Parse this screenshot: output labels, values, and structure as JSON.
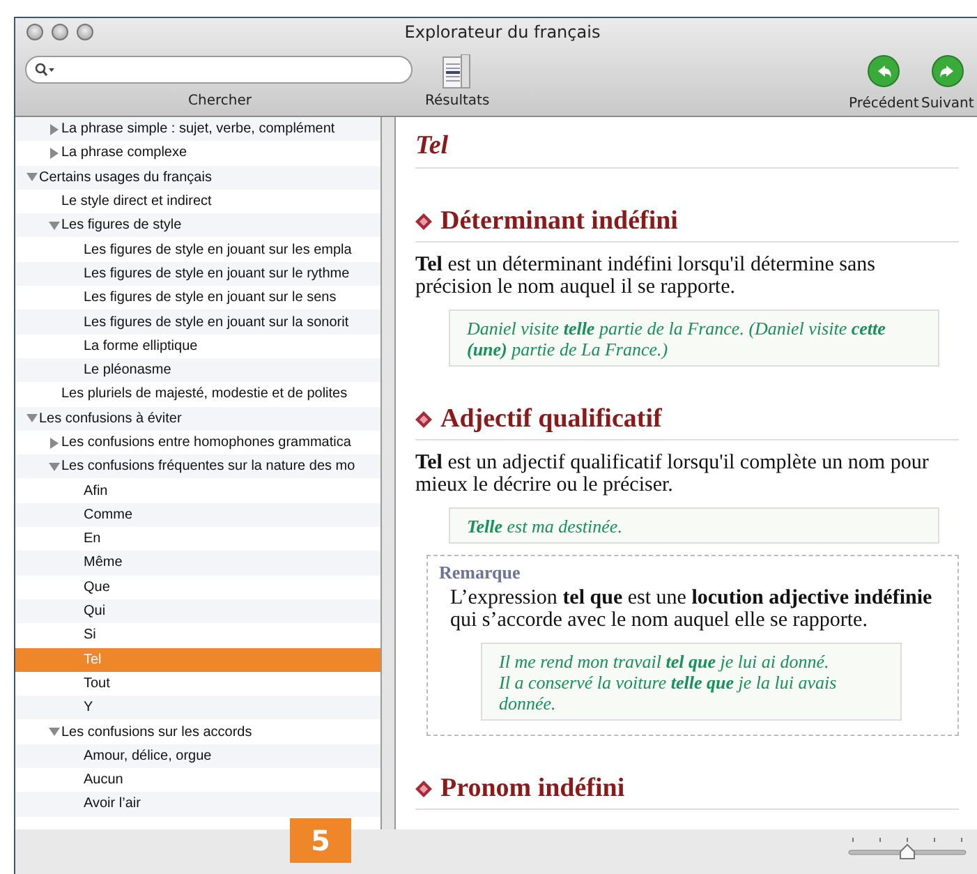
{
  "window": {
    "title": "Explorateur du français"
  },
  "toolbar": {
    "search": {
      "label": "Chercher"
    },
    "results": {
      "label": "Résultats"
    },
    "nav": [
      {
        "kind": "back",
        "label": "Précédent"
      },
      {
        "kind": "forward",
        "label": "Suivant"
      }
    ]
  },
  "tree": {
    "continued_children": [
      {
        "label": "La phrase simple : sujet, verbe, complément",
        "expanded": false,
        "selected": false
      },
      {
        "label": "La phrase complexe",
        "expanded": false,
        "selected": false
      }
    ],
    "items": [
      {
        "label": "Certains usages du français",
        "expanded": true,
        "selected": false,
        "children": [
          {
            "label": "Le style direct et indirect",
            "selected": false
          },
          {
            "label": "Les figures de style",
            "expanded": true,
            "selected": false,
            "children": [
              {
                "label": "Les figures de style en jouant sur les empla",
                "selected": false
              },
              {
                "label": "Les figures de style en jouant sur le rythme",
                "selected": false
              },
              {
                "label": "Les figures de style en jouant sur le sens",
                "selected": false
              },
              {
                "label": "Les figures de style en jouant sur la sonorit",
                "selected": false
              },
              {
                "label": "La forme elliptique",
                "selected": false
              },
              {
                "label": "Le pléonasme",
                "selected": false
              }
            ]
          },
          {
            "label": "Les pluriels de majesté, modestie et de polites",
            "selected": false
          }
        ]
      },
      {
        "label": "Les confusions à éviter",
        "expanded": true,
        "selected": false,
        "children": [
          {
            "label": "Les confusions entre homophones grammatica",
            "expanded": false,
            "selected": false
          },
          {
            "label": "Les confusions fréquentes sur la nature des mo",
            "expanded": true,
            "selected": false,
            "children": [
              {
                "label": "Afin",
                "selected": false
              },
              {
                "label": "Comme",
                "selected": false
              },
              {
                "label": "En",
                "selected": false
              },
              {
                "label": "Même",
                "selected": false
              },
              {
                "label": "Que",
                "selected": false
              },
              {
                "label": "Qui",
                "selected": false
              },
              {
                "label": "Si",
                "selected": false
              },
              {
                "label": "Tel",
                "selected": true
              },
              {
                "label": "Tout",
                "selected": false
              },
              {
                "label": "Y",
                "selected": false
              }
            ]
          },
          {
            "label": "Les confusions sur les accords",
            "expanded": true,
            "selected": false,
            "children": [
              {
                "label": "Amour, délice, orgue",
                "selected": false
              },
              {
                "label": "Aucun",
                "selected": false
              },
              {
                "label": "Avoir l’air",
                "selected": false
              }
            ]
          }
        ]
      }
    ]
  },
  "article": {
    "title": "Tel",
    "sections": [
      {
        "heading": "Déterminant indéfini",
        "blocks": [
          {
            "kind": "definition",
            "text": "**Tel** est un déterminant indéfini lorsqu'il détermine sans précision le nom auquel il se rapporte."
          },
          {
            "kind": "example",
            "lines": [
              "Daniel visite **telle** partie de la France. (Daniel visite **cette** **(une)** partie de La France.)"
            ]
          }
        ]
      },
      {
        "heading": "Adjectif qualificatif",
        "blocks": [
          {
            "kind": "definition",
            "text": "**Tel** est un adjectif qualificatif lorsqu'il complète un nom pour mieux le décrire ou le préciser."
          },
          {
            "kind": "example",
            "lines": [
              "**Telle** est ma destinée."
            ]
          },
          {
            "kind": "remark",
            "label": "Remarque",
            "text": "L’expression **tel que** est une **locution adjective indéfinie** qui s’accorde avec le nom auquel elle se rapporte.",
            "lines": [
              "Il me rend mon travail **tel que** je lui ai donné.",
              "Il a conservé la voiture **telle que** je la lui avais donnée."
            ]
          }
        ]
      },
      {
        "heading": "Pronom indéfini"
      }
    ]
  },
  "zoom_slider": {
    "level": 0.5
  },
  "callout": {
    "number": "5"
  }
}
